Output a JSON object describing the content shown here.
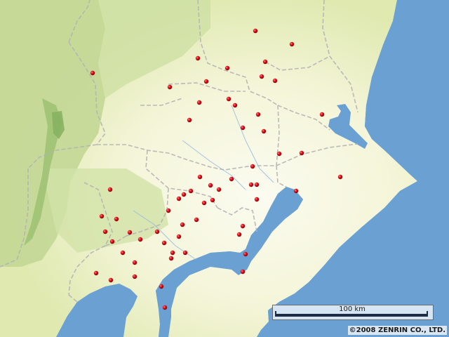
{
  "map": {
    "marker_color": "#e2101a",
    "land_colors": {
      "mountain": "#bcd38e",
      "lowland": "#f5f6dc",
      "water": "#6aa0d2"
    },
    "marker_count": 76
  },
  "scale_bar": {
    "label": "100 km"
  },
  "copyright": {
    "text": "©2008 ZENRIN CO., LTD."
  },
  "icons": {
    "marker": "red-dot-marker-icon"
  }
}
